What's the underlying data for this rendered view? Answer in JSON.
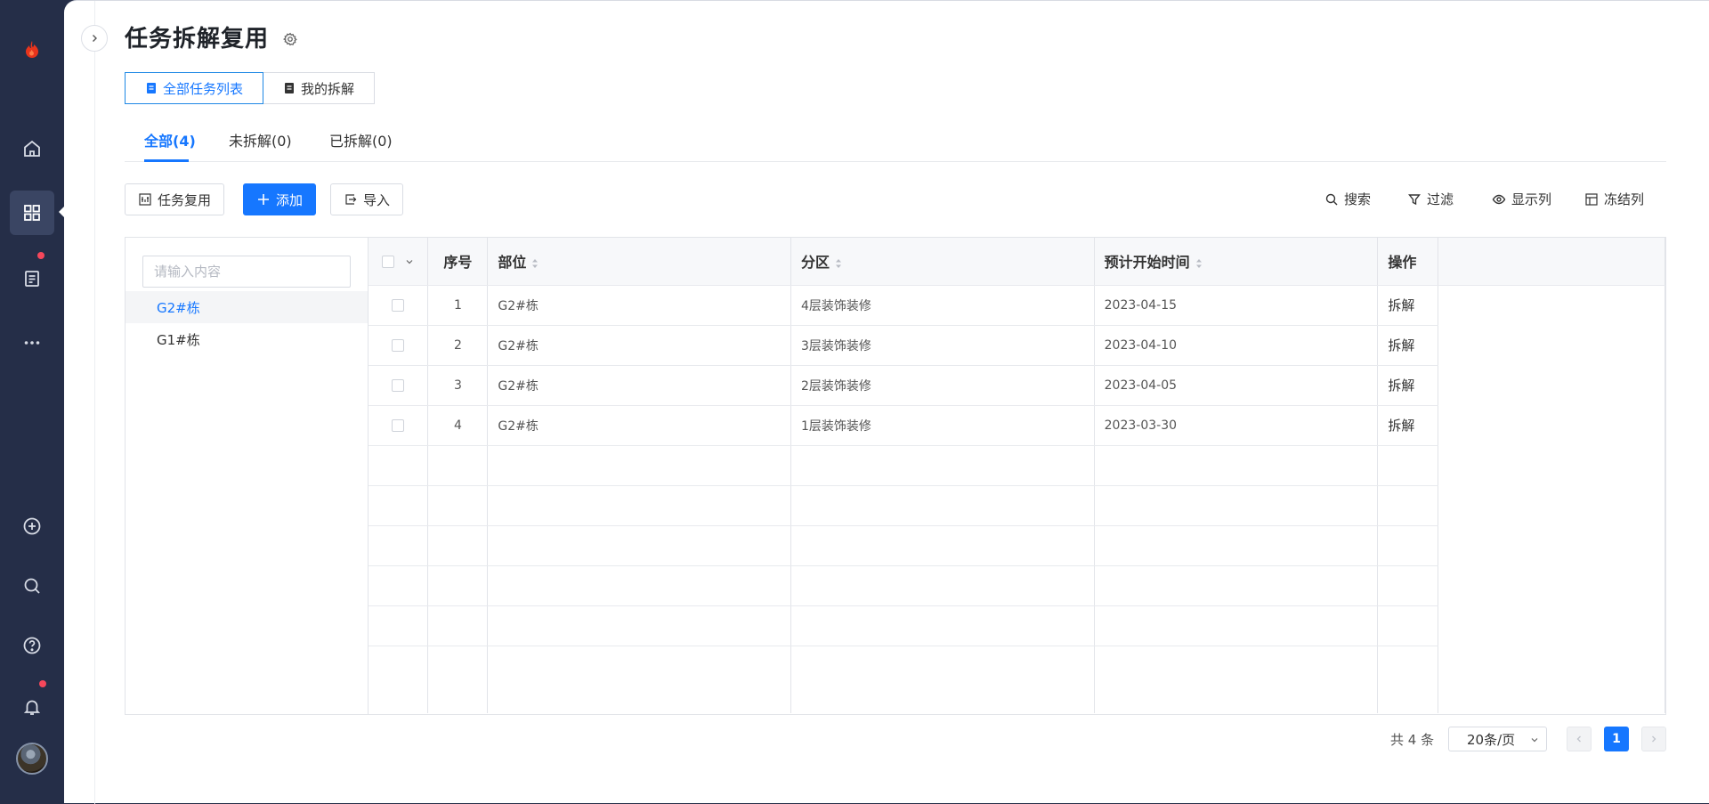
{
  "page": {
    "title": "任务拆解复用"
  },
  "view_switch": [
    {
      "label": "全部任务列表",
      "active": true
    },
    {
      "label": "我的拆解",
      "active": false
    }
  ],
  "tabs": [
    {
      "label": "全部(4)",
      "active": true
    },
    {
      "label": "未拆解(0)",
      "active": false
    },
    {
      "label": "已拆解(0)",
      "active": false
    }
  ],
  "toolbar": {
    "reuse_label": "任务复用",
    "add_label": "添加",
    "import_label": "导入",
    "search_label": "搜索",
    "filter_label": "过滤",
    "show_columns_label": "显示列",
    "freeze_columns_label": "冻结列"
  },
  "tree": {
    "search_placeholder": "请输入内容",
    "nodes": [
      {
        "label": "G2#栋",
        "selected": true
      },
      {
        "label": "G1#栋",
        "selected": false
      }
    ]
  },
  "table": {
    "headers": {
      "index": "序号",
      "location": "部位",
      "zone": "分区",
      "start": "预计开始时间",
      "actions": "操作"
    },
    "rows": [
      {
        "index": "1",
        "location": "G2#栋",
        "zone": "4层装饰装修",
        "start": "2023-04-15",
        "action": "拆解"
      },
      {
        "index": "2",
        "location": "G2#栋",
        "zone": "3层装饰装修",
        "start": "2023-04-10",
        "action": "拆解"
      },
      {
        "index": "3",
        "location": "G2#栋",
        "zone": "2层装饰装修",
        "start": "2023-04-05",
        "action": "拆解"
      },
      {
        "index": "4",
        "location": "G2#栋",
        "zone": "1层装饰装修",
        "start": "2023-03-30",
        "action": "拆解"
      }
    ]
  },
  "pagination": {
    "total": "共 4 条",
    "page_size": "20条/页",
    "current_page": "1"
  },
  "colors": {
    "accent": "#1677ff",
    "rail": "#252e48",
    "notification_dot": "#f5475b",
    "logo": "#e8341c"
  },
  "icons": {
    "logo": "flame-icon",
    "rail": [
      "home-icon",
      "grid-icon",
      "document-icon",
      "more-icon",
      "add-circle-icon",
      "search-icon",
      "help-icon",
      "bell-icon"
    ]
  }
}
